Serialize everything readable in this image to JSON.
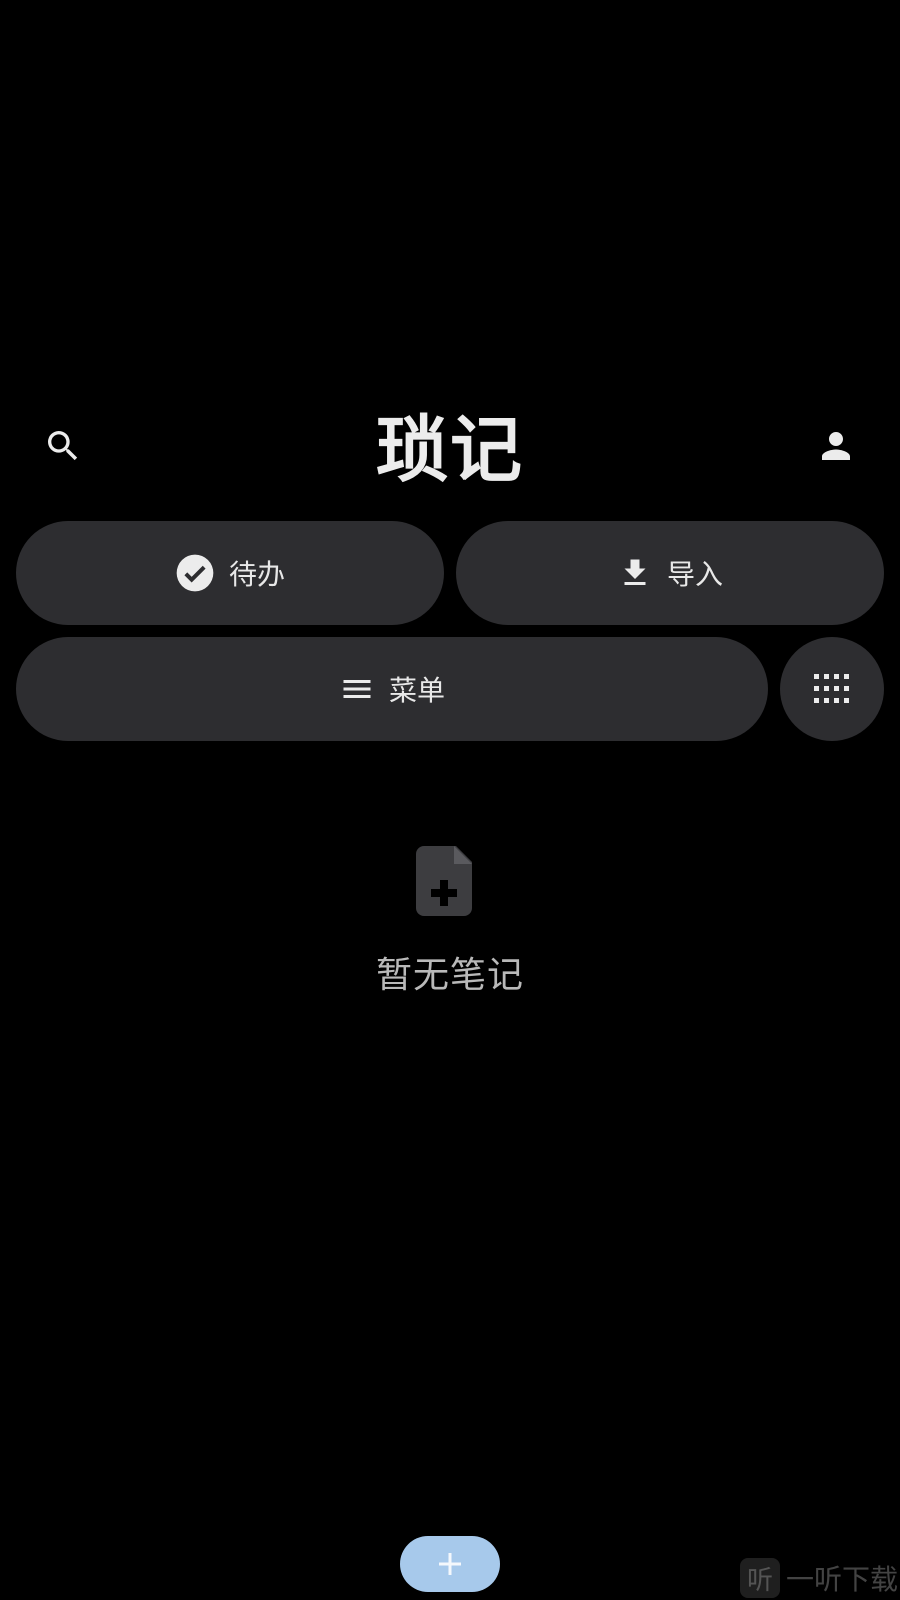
{
  "app": {
    "title": "琐记"
  },
  "header": {
    "search_icon": "search-icon",
    "account_icon": "person-icon"
  },
  "actions": {
    "todo_label": "待办",
    "todo_icon": "check-circle-icon",
    "import_label": "导入",
    "import_icon": "download-icon",
    "menu_label": "菜单",
    "menu_icon": "hamburger-menu-icon",
    "grid_icon": "grid-dots-icon"
  },
  "empty_state": {
    "icon": "note-add-icon",
    "text": "暂无笔记"
  },
  "fab": {
    "icon": "plus-icon",
    "color": "#a7c9eb"
  },
  "watermark": {
    "logo_char": "听",
    "text": "一听下载"
  },
  "colors": {
    "background": "#000000",
    "surface": "#2d2d30",
    "accent": "#a7c9eb"
  }
}
